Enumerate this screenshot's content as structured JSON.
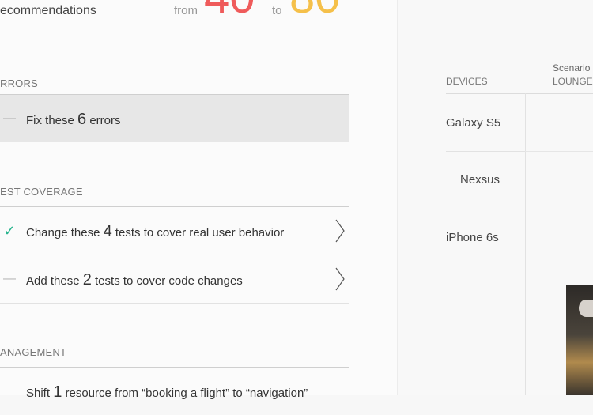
{
  "header": {
    "title_partial": "ecommendations",
    "from_label": "from",
    "score_from": "40",
    "to_label": "to",
    "score_to": "80"
  },
  "sections": {
    "errors": {
      "label": "RRORS",
      "item": {
        "pre": "Fix these ",
        "num": "6",
        "post": " errors"
      }
    },
    "test_coverage": {
      "label": "EST COVERAGE",
      "items": [
        {
          "pre": "Change these ",
          "num": "4",
          "post": " tests to cover real user behavior"
        },
        {
          "pre": "Add these ",
          "num": "2",
          "post": " tests to cover code changes"
        }
      ]
    },
    "management": {
      "label": "ANAGEMENT",
      "item": {
        "pre": "Shift ",
        "num": "1",
        "post": " resource from “booking a flight” to “navigation”"
      }
    }
  },
  "devices_table": {
    "devices_header": "DEVICES",
    "scenario_label": "Scenario",
    "scenario_name": "LOUNGE",
    "devices": [
      "Galaxy S5",
      "Nexsus",
      "iPhone 6s"
    ]
  },
  "colors": {
    "score_from": "#ef5b5b",
    "score_to": "#f5c04a",
    "check": "#2ab58f",
    "highlight_row": "#e7e7e7"
  },
  "icons": [
    "check-icon",
    "dash-icon",
    "chevron-right-icon"
  ]
}
